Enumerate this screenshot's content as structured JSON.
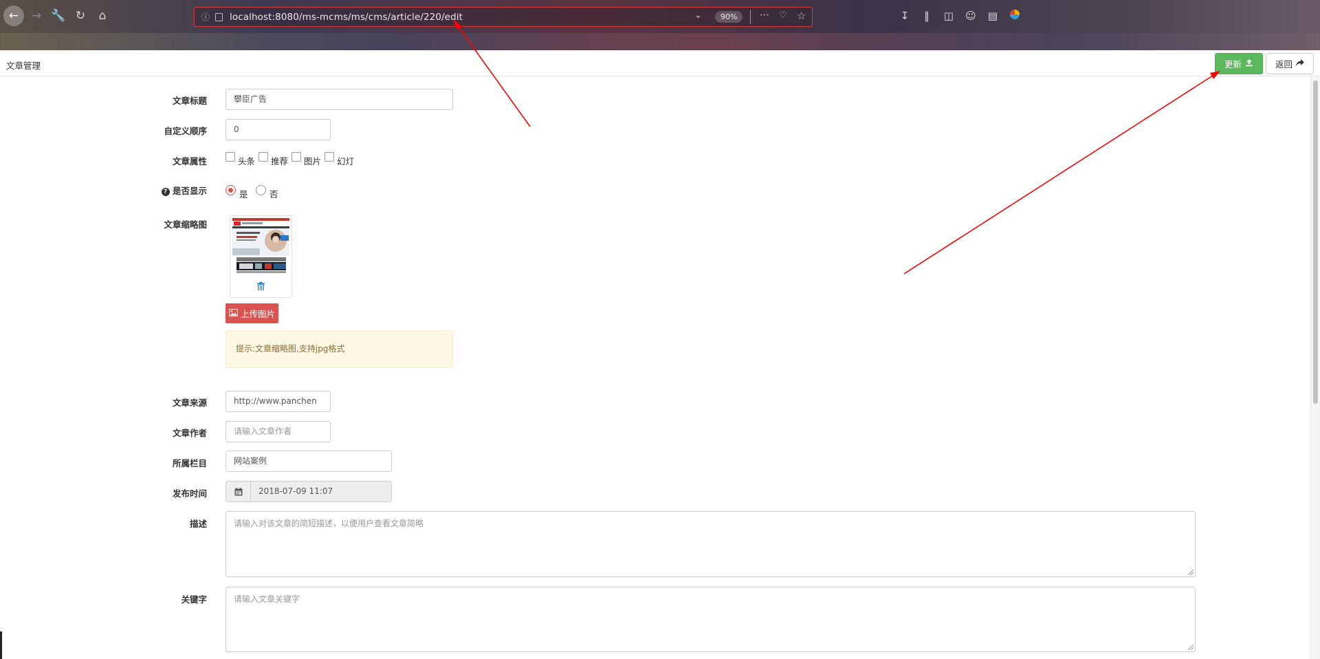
{
  "browser": {
    "url": "localhost:8080/ms-mcms/ms/cms/article/220/edit",
    "zoom": "90%"
  },
  "header": {
    "title": "文章管理",
    "update_label": "更新",
    "back_label": "返回"
  },
  "form": {
    "title_label": "文章标题",
    "title_value": "攀臣广告",
    "order_label": "自定义顺序",
    "order_value": "0",
    "attr_label": "文章属性",
    "attrs": [
      "头条",
      "推荐",
      "图片",
      "幻灯"
    ],
    "display_label": "是否显示",
    "display_yes": "是",
    "display_no": "否",
    "thumb_label": "文章缩略图",
    "upload_label": "上传图片",
    "hint": "提示:文章缩略图,支持jpg格式",
    "source_label": "文章来源",
    "source_value": "http://www.panchen",
    "author_label": "文章作者",
    "author_placeholder": "请输入文章作者",
    "column_label": "所属栏目",
    "column_value": "网站案例",
    "date_label": "发布时间",
    "date_value": "2018-07-09 11:07",
    "desc_label": "描述",
    "desc_placeholder": "请输入对该文章的简短描述，以便用户查看文章简略",
    "keyword_label": "关键字",
    "keyword_placeholder": "请输入文章关键字"
  },
  "colors": {
    "update_button": "#5cb85c",
    "upload_button": "#d9534f",
    "annotation_arrow": "#ff0000"
  }
}
